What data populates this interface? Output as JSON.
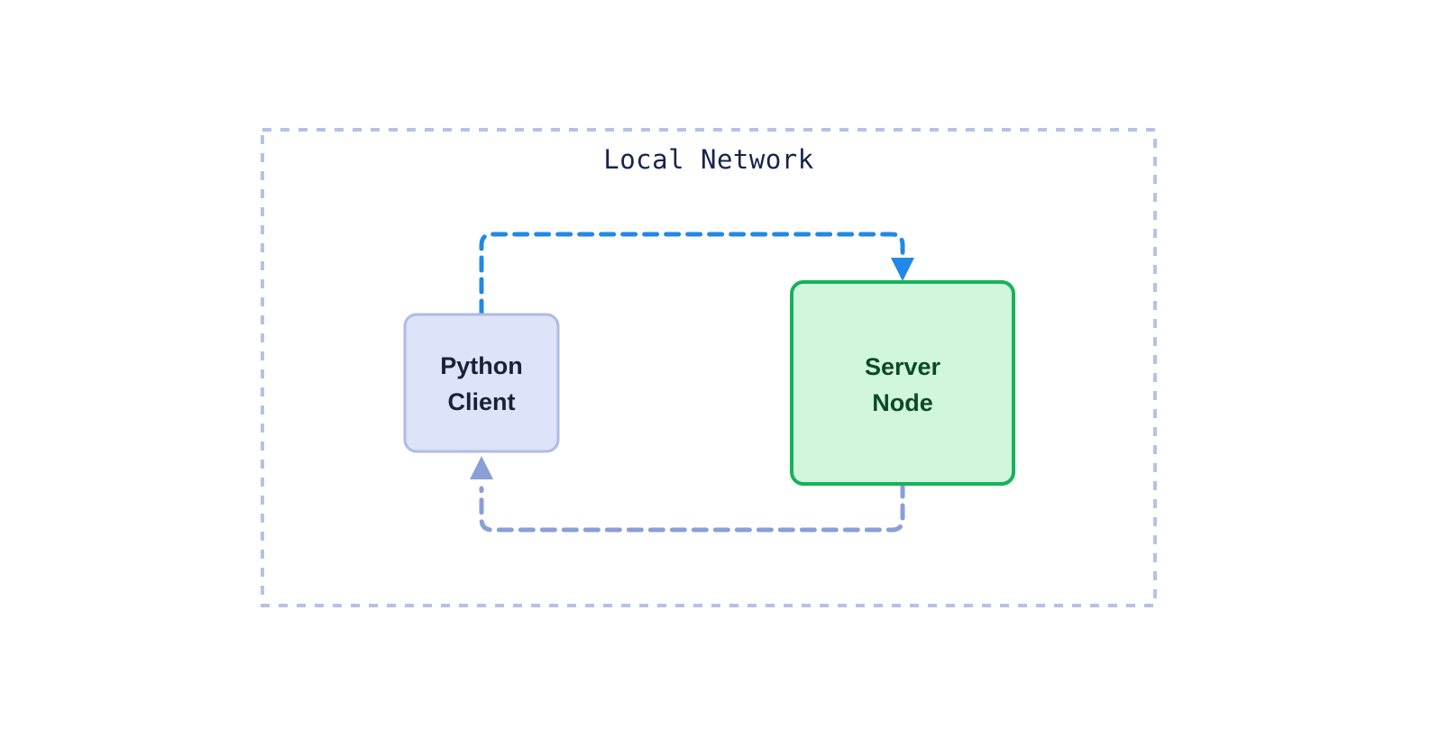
{
  "diagram": {
    "title": "Local Network",
    "background_color": "#ffffff",
    "container": {
      "label": "Local Network",
      "border_color": "#b5c2e8",
      "border_style": "dashed",
      "fill": "#ffffff"
    },
    "nodes": [
      {
        "id": "python-client",
        "label_line1": "Python",
        "label_line2": "Client",
        "fill": "#dde3f8",
        "border_color": "#aebbe4",
        "text_color": "#1a2137"
      },
      {
        "id": "server-node",
        "label_line1": "Server",
        "label_line2": "Node",
        "fill": "#d0f7db",
        "border_color": "#15b25c",
        "text_color": "#0c4a27"
      }
    ],
    "edges": [
      {
        "id": "request-edge",
        "from": "python-client",
        "to": "server-node",
        "color": "#2188e8",
        "style": "dashed",
        "direction": "client-to-server"
      },
      {
        "id": "response-edge",
        "from": "server-node",
        "to": "python-client",
        "color": "#8a9ed8",
        "style": "dashed",
        "direction": "server-to-client"
      }
    ]
  }
}
